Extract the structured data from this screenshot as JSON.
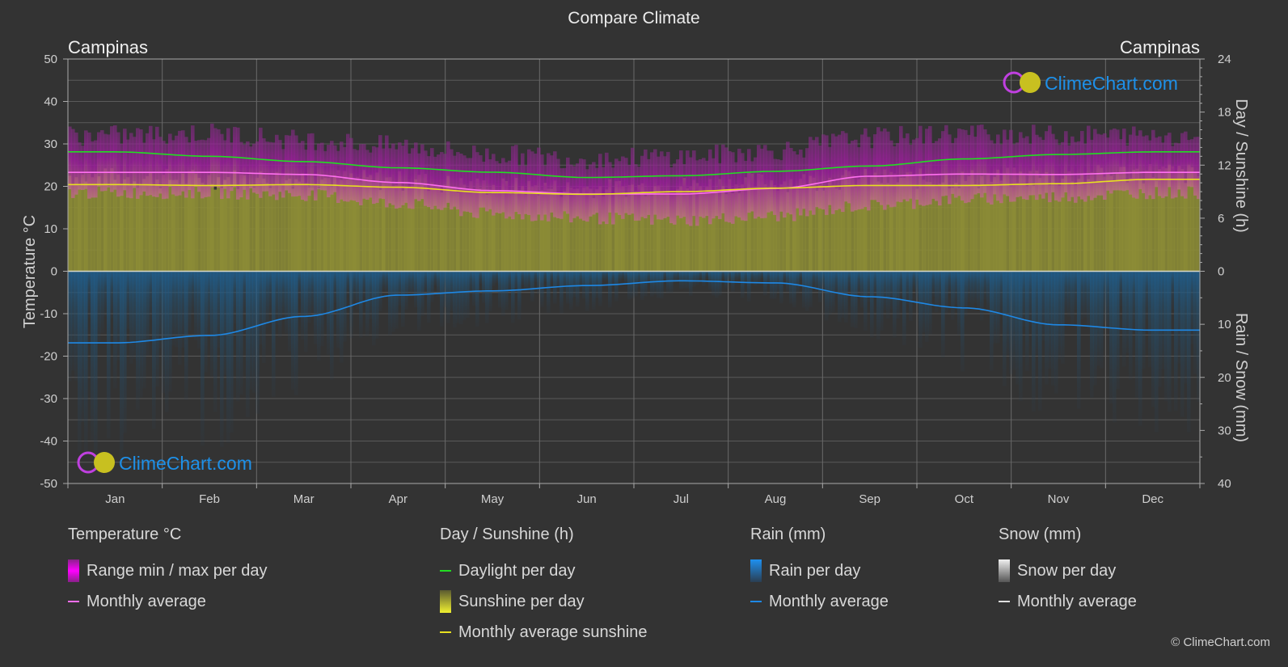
{
  "page": {
    "title": "Compare Climate",
    "location_left": "Campinas",
    "location_right": "Campinas",
    "watermark": "ClimeChart.com",
    "copyright": "© ClimeChart.com"
  },
  "legend": {
    "groups": [
      {
        "title": "Temperature °C",
        "items": [
          {
            "label": "Range min / max per day",
            "kind": "box",
            "color": "#e020e0"
          },
          {
            "label": "Monthly average",
            "kind": "line",
            "color": "#ff6ff0"
          }
        ]
      },
      {
        "title": "Day / Sunshine (h)",
        "items": [
          {
            "label": "Daylight per day",
            "kind": "line",
            "color": "#22dd22"
          },
          {
            "label": "Sunshine per day",
            "kind": "box",
            "color": "#e8e83a"
          },
          {
            "label": "Monthly average sunshine",
            "kind": "line",
            "color": "#e8e020"
          }
        ]
      },
      {
        "title": "Rain (mm)",
        "items": [
          {
            "label": "Rain per day",
            "kind": "box",
            "color": "#1e88e5"
          },
          {
            "label": "Monthly average",
            "kind": "line",
            "color": "#1e88e5"
          }
        ]
      },
      {
        "title": "Snow (mm)",
        "items": [
          {
            "label": "Snow per day",
            "kind": "box",
            "color": "#e0e0e0"
          },
          {
            "label": "Monthly average",
            "kind": "line",
            "color": "#e0e0e0"
          }
        ]
      }
    ]
  },
  "chart_data": {
    "type": "line",
    "title": "Compare Climate",
    "categories": [
      "Jan",
      "Feb",
      "Mar",
      "Apr",
      "May",
      "Jun",
      "Jul",
      "Aug",
      "Sep",
      "Oct",
      "Nov",
      "Dec"
    ],
    "axes": {
      "left": {
        "label": "Temperature °C",
        "range": [
          -50,
          50
        ],
        "ticks": [
          50,
          40,
          30,
          20,
          10,
          0,
          -10,
          -20,
          -30,
          -40,
          -50
        ]
      },
      "right_top": {
        "label": "Day / Sunshine (h)",
        "range": [
          0,
          24
        ],
        "ticks": [
          24,
          18,
          12,
          6,
          0
        ]
      },
      "right_bottom": {
        "label": "Rain / Snow (mm)",
        "range": [
          0,
          40
        ],
        "ticks": [
          10,
          20,
          30,
          40
        ]
      }
    },
    "grid": true,
    "series": [
      {
        "name": "Daylight per day",
        "axis": "right_top",
        "unit": "h",
        "color": "#22dd22",
        "values": [
          13.5,
          13.0,
          12.4,
          11.7,
          11.2,
          10.6,
          10.8,
          11.3,
          11.9,
          12.7,
          13.2,
          13.5
        ]
      },
      {
        "name": "Temperature monthly average",
        "axis": "left",
        "unit": "°C",
        "color": "#ff6ff0",
        "values": [
          23.3,
          23.3,
          22.8,
          20.9,
          19.0,
          18.2,
          18.2,
          19.5,
          22.4,
          22.9,
          22.8,
          23.3
        ]
      },
      {
        "name": "Monthly average sunshine",
        "axis": "right_top",
        "unit": "h",
        "color": "#e8e020",
        "values": [
          9.8,
          9.7,
          9.8,
          9.5,
          8.9,
          8.7,
          9.0,
          9.4,
          9.7,
          9.7,
          9.9,
          10.4
        ]
      },
      {
        "name": "Rain monthly average",
        "axis": "right_bottom",
        "unit": "mm",
        "color": "#1e88e5",
        "values": [
          13.5,
          12.1,
          8.5,
          4.5,
          3.7,
          2.7,
          1.8,
          2.2,
          4.8,
          6.9,
          10.1,
          11.1
        ]
      }
    ],
    "bands": [
      {
        "name": "Temperature range min / max per day",
        "axis": "left",
        "unit": "°C",
        "min": [
          18.5,
          18.5,
          18.0,
          16.0,
          13.5,
          12.5,
          12.0,
          13.0,
          15.5,
          17.0,
          17.5,
          18.5
        ],
        "max": [
          31.0,
          31.5,
          30.0,
          28.5,
          26.5,
          25.5,
          26.0,
          27.5,
          30.5,
          31.5,
          31.0,
          31.0
        ]
      }
    ],
    "legend_position": "bottom"
  }
}
